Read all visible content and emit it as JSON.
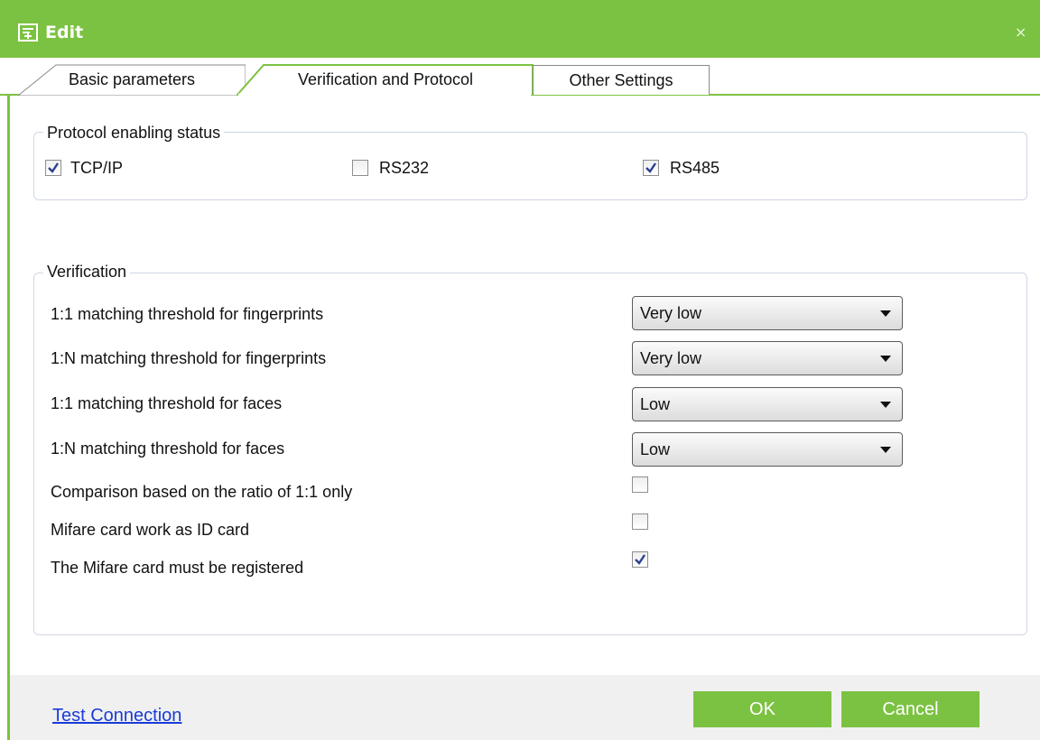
{
  "window": {
    "title": "Edit",
    "close_glyph": "×",
    "title_icon": "form-edit-icon",
    "accent_color": "#7cc242"
  },
  "tabs": [
    {
      "label": "Basic parameters",
      "active": false
    },
    {
      "label": "Verification and Protocol",
      "active": true
    },
    {
      "label": "Other Settings",
      "active": false
    }
  ],
  "protocol": {
    "legend": "Protocol enabling status",
    "options": [
      {
        "label": "TCP/IP",
        "checked": true
      },
      {
        "label": "RS232",
        "checked": false
      },
      {
        "label": "RS485",
        "checked": true
      }
    ]
  },
  "verification": {
    "legend": "Verification",
    "selects": [
      {
        "label": "1:1 matching threshold for fingerprints",
        "value": "Very low"
      },
      {
        "label": "1:N matching threshold for fingerprints",
        "value": "Very low"
      },
      {
        "label": "1:1 matching threshold for faces",
        "value": "Low"
      },
      {
        "label": "1:N matching threshold for faces",
        "value": "Low"
      }
    ],
    "checkboxes": [
      {
        "label": "Comparison based on the ratio of 1:1 only",
        "checked": false
      },
      {
        "label": "Mifare card work as ID card",
        "checked": false
      },
      {
        "label": "The Mifare card must be registered",
        "checked": true
      }
    ]
  },
  "footer": {
    "test_connection": "Test Connection",
    "ok": "OK",
    "cancel": "Cancel"
  }
}
